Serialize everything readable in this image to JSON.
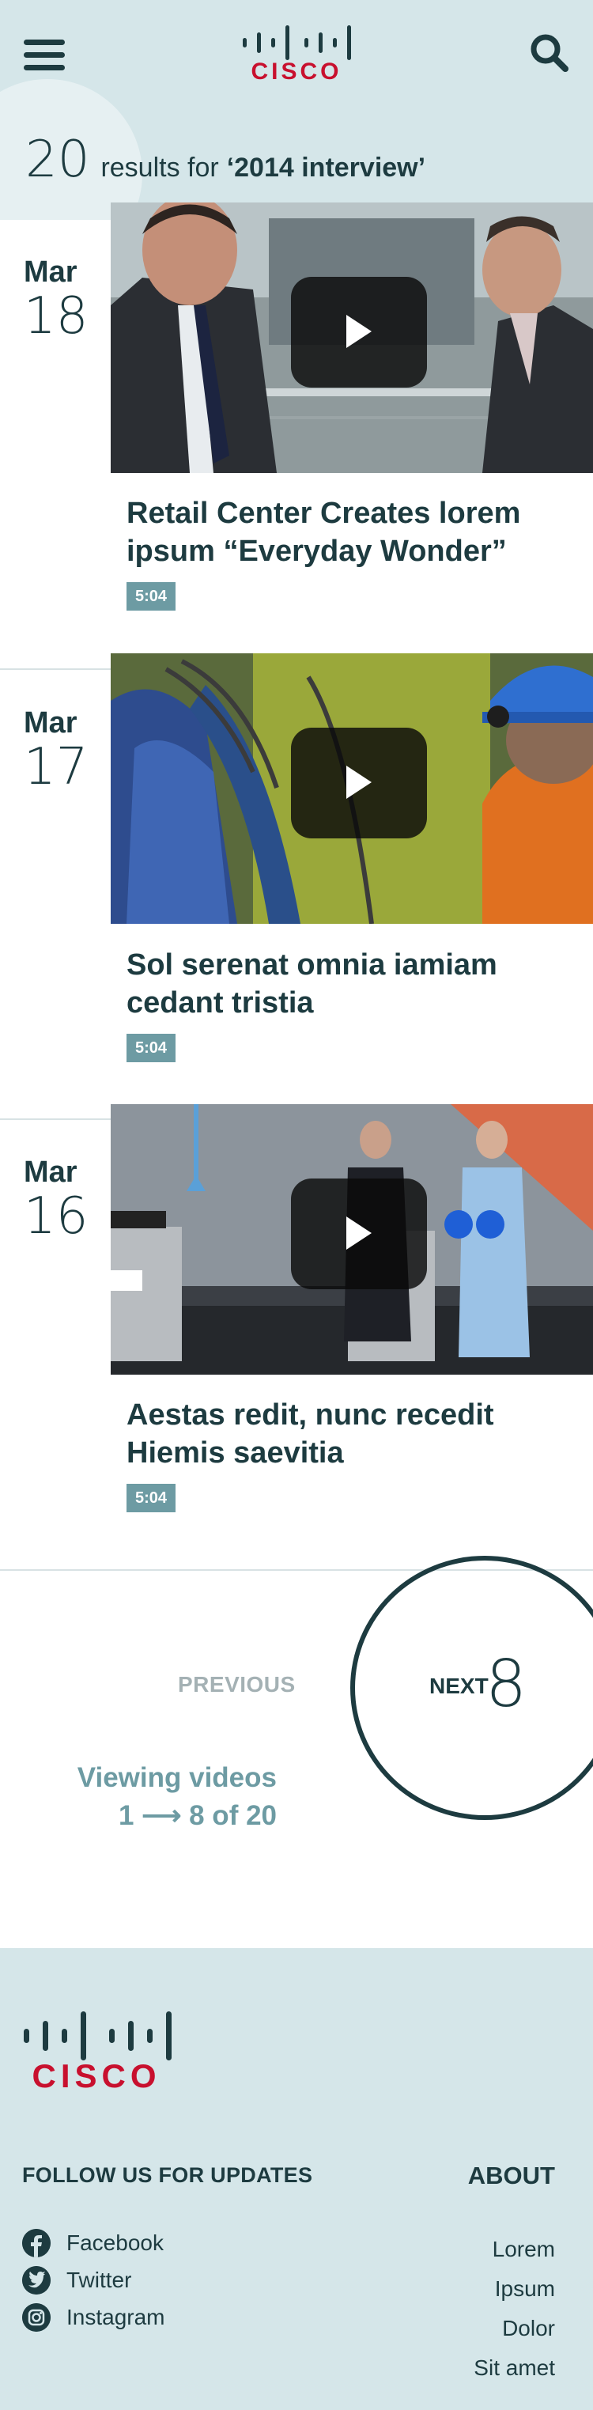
{
  "header": {
    "logo_text": "CISCO",
    "results_count": "20",
    "results_for": "results for",
    "query": "‘2014 interview’",
    "menu_icon": "hamburger-menu-icon",
    "search_icon": "search-icon"
  },
  "results": [
    {
      "month": "Mar",
      "day": "18",
      "title": "Retail Center Creates lorem ipsum “Everyday Wonder”",
      "duration": "5:04",
      "thumbnail": "two men in suits talking in a mall atrium"
    },
    {
      "month": "Mar",
      "day": "17",
      "title": "Sol serenat omnia iamiam cedant tristia",
      "duration": "5:04",
      "thumbnail": "worker in blue hard hat beside blue tanks"
    },
    {
      "month": "Mar",
      "day": "16",
      "title": "Aestas redit, nunc recedit Hiemis saevitia",
      "duration": "5:04",
      "thumbnail": "two men on stage at Cisco podiums with hard hats"
    }
  ],
  "pagination": {
    "previous_label": "PREVIOUS",
    "next_label": "NEXT",
    "next_number": "8",
    "viewing_label": "Viewing videos",
    "viewing_range": "1 ⟶ 8 of 20"
  },
  "footer": {
    "logo_text": "CISCO",
    "follow_heading": "FOLLOW US FOR UPDATES",
    "about_heading": "ABOUT",
    "social": [
      {
        "label": "Facebook",
        "icon": "facebook-icon"
      },
      {
        "label": "Twitter",
        "icon": "twitter-icon"
      },
      {
        "label": "Instagram",
        "icon": "instagram-icon"
      }
    ],
    "about_links": [
      "Lorem",
      "Ipsum",
      "Dolor",
      "Sit amet"
    ]
  },
  "colors": {
    "header_bg": "#d5e6e9",
    "dark_teal": "#1d3b40",
    "accent_teal": "#6d9ba3",
    "cisco_red": "#c8102e",
    "muted_gray": "#a4b1b4"
  }
}
